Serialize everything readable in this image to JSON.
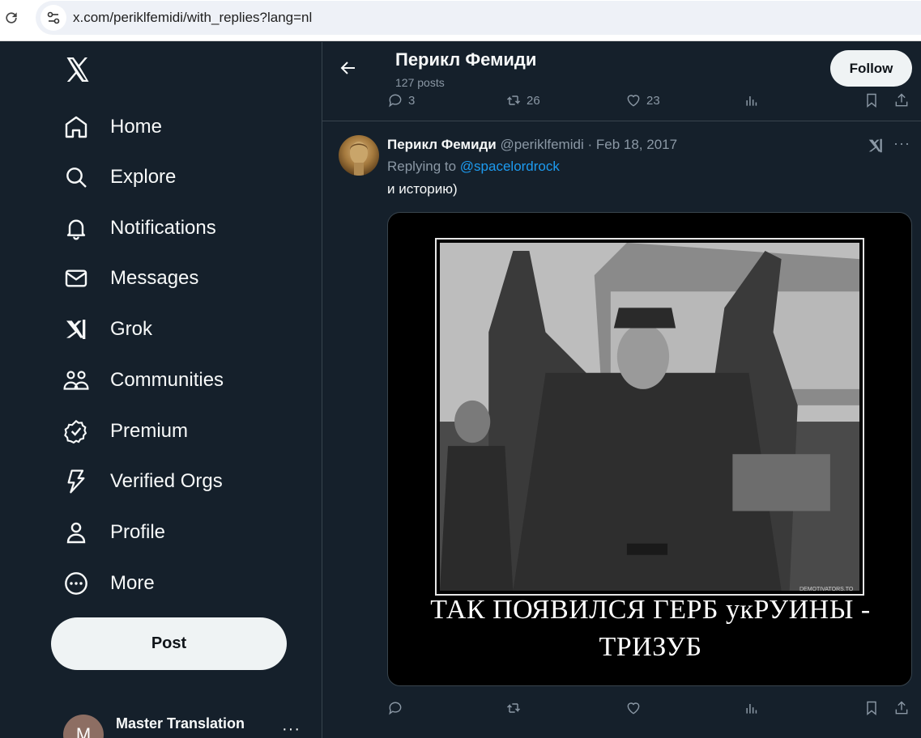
{
  "browser": {
    "url": "x.com/periklfemidi/with_replies?lang=nl"
  },
  "sidebar": {
    "logo": "x-logo-icon",
    "items": [
      {
        "label": "Home",
        "icon": "home-icon"
      },
      {
        "label": "Explore",
        "icon": "search-icon"
      },
      {
        "label": "Notifications",
        "icon": "bell-icon"
      },
      {
        "label": "Messages",
        "icon": "envelope-icon"
      },
      {
        "label": "Grok",
        "icon": "grok-icon"
      },
      {
        "label": "Communities",
        "icon": "people-icon"
      },
      {
        "label": "Premium",
        "icon": "verified-badge-icon"
      },
      {
        "label": "Verified Orgs",
        "icon": "lightning-icon"
      },
      {
        "label": "Profile",
        "icon": "person-icon"
      },
      {
        "label": "More",
        "icon": "more-circle-icon"
      }
    ],
    "post_label": "Post",
    "account": {
      "initial": "M",
      "name": "Master Translation",
      "more": "···"
    }
  },
  "header": {
    "name": "Перикл Фемиди",
    "posts": "127 posts",
    "follow_label": "Follow"
  },
  "prev_tweet_actions": {
    "replies": "3",
    "reposts": "26",
    "likes": "23"
  },
  "tweet": {
    "name": "Перикл Фемиди",
    "handle": "@periklfemidi",
    "separator": "·",
    "date": "Feb 18, 2017",
    "replying_prefix": "Replying to",
    "replying_to": "@spacelordrock",
    "text": "и историю)",
    "media": {
      "caption_line1": "ТАК ПОЯВИЛСЯ ГЕРБ укРУИНЫ -",
      "caption_line2": "ТРИЗУБ",
      "watermark": "DEMOTIVATORS.TO"
    },
    "more": "···"
  },
  "colors": {
    "background": "#15202b",
    "border": "#38444d",
    "secondary_text": "#8b98a5",
    "link": "#1d9bf0"
  }
}
